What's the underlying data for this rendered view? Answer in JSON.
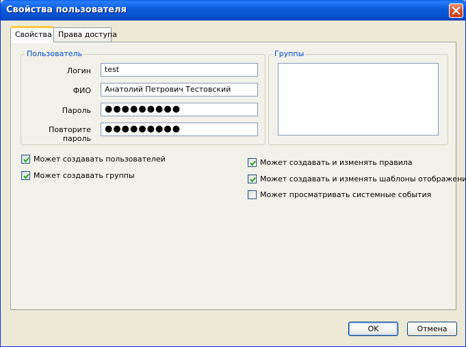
{
  "window": {
    "title": "Свойства пользователя"
  },
  "tabs": [
    {
      "label": "Свойства",
      "active": true
    },
    {
      "label": "Права доступа",
      "active": false
    }
  ],
  "user_group": {
    "legend": "Пользователь",
    "fields": {
      "login_label": "Логин",
      "login_value": "test",
      "fio_label": "ФИО",
      "fio_value": "Анатолий Петрович Тестовский",
      "password_label": "Пароль",
      "password_value": "●●●●●●●●●",
      "repeat_label_line1": "Повторите",
      "repeat_label_line2": "пароль",
      "repeat_value": "●●●●●●●●●"
    }
  },
  "groups_group": {
    "legend": "Группы",
    "items": []
  },
  "permissions_left": [
    {
      "label": "Может создавать пользователей",
      "checked": true
    },
    {
      "label": "Может создавать группы",
      "checked": true
    }
  ],
  "permissions_right": [
    {
      "label": "Может создавать и изменять правила",
      "checked": true
    },
    {
      "label": "Может создавать и изменять шаблоны отображения",
      "checked": true
    },
    {
      "label": "Может просматривать системные события",
      "checked": false
    }
  ],
  "buttons": {
    "ok": "OK",
    "cancel": "Отмена"
  },
  "colors": {
    "title_bar": "#0a5ad8",
    "legend_text": "#0046d5",
    "checkmark": "#21a121",
    "close_button": "#d9502a"
  }
}
